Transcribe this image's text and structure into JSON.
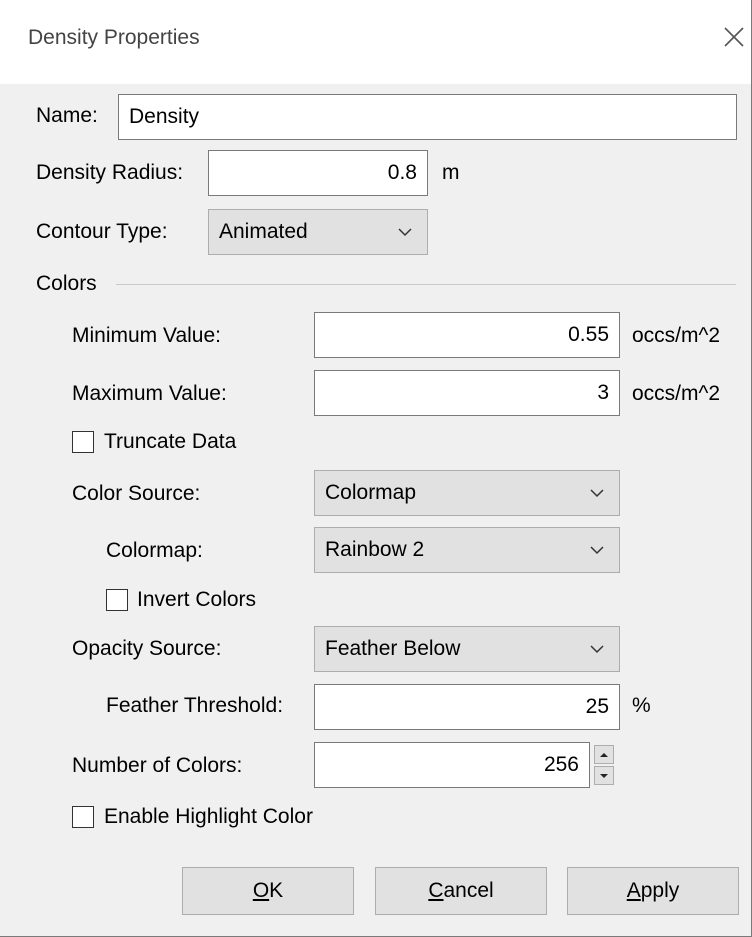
{
  "window": {
    "title": "Density Properties"
  },
  "general": {
    "name_label": "Name:",
    "name_value": "Density",
    "radius_label": "Density Radius:",
    "radius_value": "0.8",
    "radius_unit": "m",
    "contour_label": "Contour Type:",
    "contour_value": "Animated"
  },
  "colors": {
    "group_label": "Colors",
    "min_label": "Minimum Value:",
    "min_value": "0.55",
    "min_unit": "occs/m^2",
    "max_label": "Maximum Value:",
    "max_value": "3",
    "max_unit": "occs/m^2",
    "truncate_label": "Truncate Data",
    "truncate_checked": false,
    "source_label": "Color Source:",
    "source_value": "Colormap",
    "colormap_label": "Colormap:",
    "colormap_value": "Rainbow 2",
    "invert_label": "Invert Colors",
    "invert_checked": false,
    "opacity_label": "Opacity Source:",
    "opacity_value": "Feather Below",
    "feather_label": "Feather Threshold:",
    "feather_value": "25",
    "feather_unit": "%",
    "num_colors_label": "Number of Colors:",
    "num_colors_value": "256",
    "highlight_label": "Enable Highlight Color",
    "highlight_checked": false
  },
  "buttons": {
    "ok_mnemonic": "O",
    "ok_rest": "K",
    "cancel_mnemonic": "C",
    "cancel_rest": "ancel",
    "apply_mnemonic": "A",
    "apply_rest": "pply"
  }
}
